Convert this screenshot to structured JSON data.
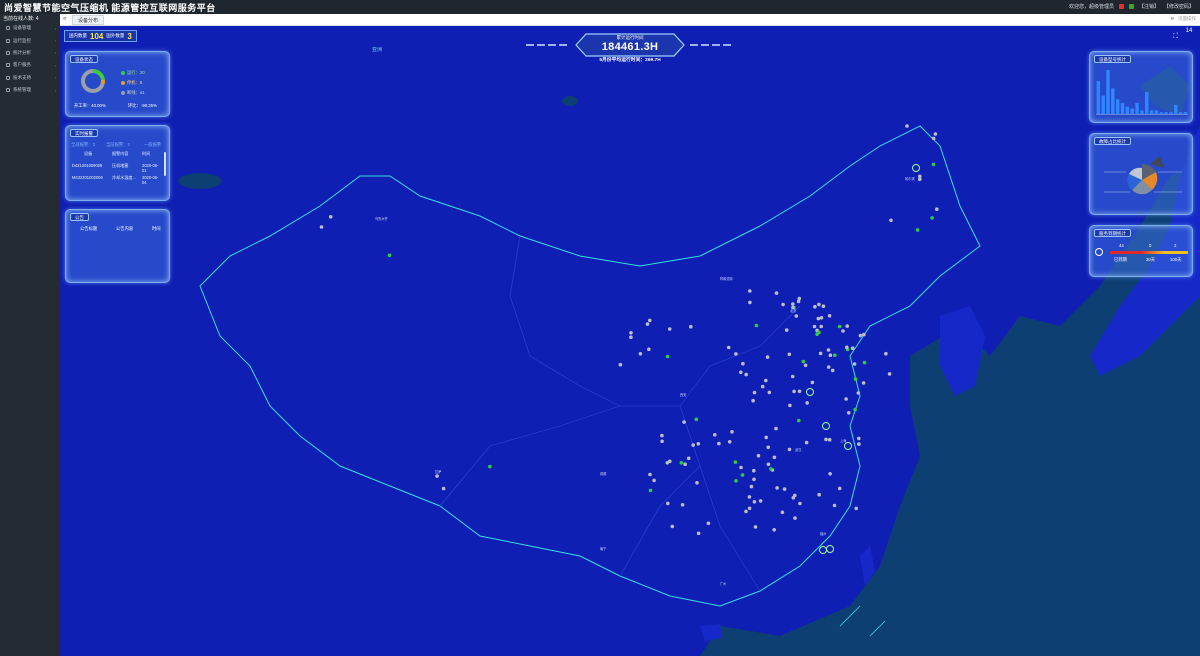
{
  "header": {
    "brand": "尚爱智慧节能空气压缩机 能源管控互联网服务平台",
    "welcome": "欢迎您，超级管理员",
    "logout": "【注销】",
    "change_password": "【修改密码】"
  },
  "sidebar": {
    "online": "当前在线人数: 4",
    "items": [
      {
        "label": "设备管理",
        "icon": "device-icon"
      },
      {
        "label": "运行监控",
        "icon": "monitor-icon"
      },
      {
        "label": "统计分析",
        "icon": "chart-icon"
      },
      {
        "label": "客户服务",
        "icon": "heart-icon"
      },
      {
        "label": "技术支持",
        "icon": "wrench-icon"
      },
      {
        "label": "系统管理",
        "icon": "gear-icon"
      }
    ]
  },
  "tabs": {
    "active": "设备分布",
    "menu": "页面操作"
  },
  "counts": {
    "domestic_label": "国内数量",
    "domestic_value": "104",
    "overseas_label": "国外数量",
    "overseas_value": "3"
  },
  "runtime": {
    "label": "累计运行时间",
    "value": "184461.3H",
    "sub": "5月份平均运行时间：269.7H"
  },
  "device_status": {
    "title": "设备状态",
    "legend": [
      {
        "label": "运行：20",
        "color": "#3dcc3d"
      },
      {
        "label": "停机：6",
        "color": "#e0a020"
      },
      {
        "label": "断线：61",
        "color": "#9aa0a8"
      }
    ],
    "ring": {
      "running": 20,
      "stopped": 6,
      "offline": 61
    },
    "start_rate": "开工率：40.00%",
    "ratio": "环比：-90.25%"
  },
  "realtime_alarm": {
    "title": "实时报警",
    "filters": [
      "全部报警：3",
      "当前报警：3",
      "一般报警"
    ],
    "columns": [
      "设备",
      "报警内容",
      "时间"
    ],
    "rows": [
      {
        "device": "D421201009005",
        "content": "压机堵塞",
        "time": "2020-06-01"
      },
      {
        "device": "M432201002006",
        "content": "冷却水温度...",
        "time": "2020-06-04"
      }
    ]
  },
  "notice": {
    "title": "公告",
    "columns": [
      "公告标题",
      "公告内容",
      "时间"
    ]
  },
  "model_stats": {
    "title": "设备型号统计",
    "bars": [
      18,
      10,
      24,
      14,
      8,
      6,
      4,
      3,
      6,
      2,
      12,
      2,
      2,
      1,
      1,
      1,
      5,
      1,
      1
    ]
  },
  "fault_stats": {
    "title": "故障占比统计"
  },
  "service_stats": {
    "title": "服务到期统计",
    "values": [
      "44",
      "0",
      "2"
    ],
    "labels": [
      "已到期",
      "30天",
      "100天"
    ]
  },
  "map": {
    "region_label": "亚洲",
    "corner": "14"
  }
}
